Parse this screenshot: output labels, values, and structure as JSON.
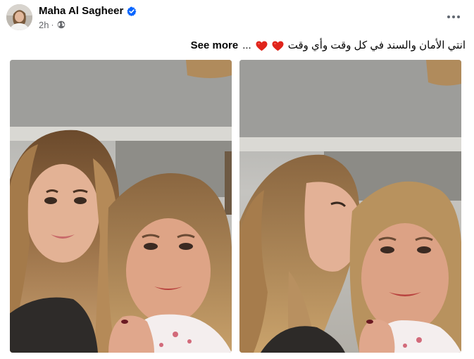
{
  "post": {
    "author": {
      "name": "Maha Al Sagheer",
      "verified": true,
      "avatar_icon": "profile-avatar"
    },
    "timestamp": "2h",
    "audience_icon": "globe-icon",
    "more_icon": "more-dots-icon",
    "caption": {
      "text": "انتي الأمان والسند في كل وقت وأي وقت",
      "emojis": [
        "red-heart",
        "red-heart"
      ],
      "ellipsis": "...",
      "see_more_label": "See more"
    },
    "photos": [
      {
        "description_icon": "photo-selfie-two-women"
      },
      {
        "description_icon": "photo-selfie-cheek-kiss"
      }
    ]
  },
  "colors": {
    "text_primary": "#050505",
    "text_secondary": "#65676b",
    "verified_blue": "#0866ff",
    "heart_red": "#e0241b"
  }
}
